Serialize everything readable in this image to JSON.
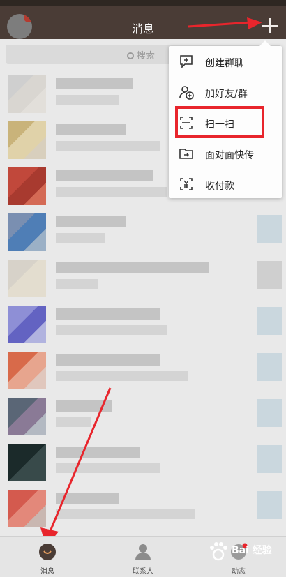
{
  "header": {
    "title": "消息"
  },
  "search": {
    "placeholder": "搜索"
  },
  "menu": {
    "items": [
      {
        "label": "创建群聊",
        "icon": "create-group-chat-icon"
      },
      {
        "label": "加好友/群",
        "icon": "add-friend-icon"
      },
      {
        "label": "扫一扫",
        "icon": "scan-icon"
      },
      {
        "label": "面对面快传",
        "icon": "folder-transfer-icon"
      },
      {
        "label": "收付款",
        "icon": "payment-icon"
      }
    ]
  },
  "tabs": [
    {
      "label": "消息",
      "icon": "message-icon"
    },
    {
      "label": "联系人",
      "icon": "contacts-icon"
    },
    {
      "label": "动态",
      "icon": "feed-icon"
    }
  ],
  "colors": {
    "header_bg": "#4a3c36",
    "highlight": "#e8252c",
    "annotation_arrow": "#e8252c"
  },
  "watermark": {
    "text": "Bai 经验"
  }
}
